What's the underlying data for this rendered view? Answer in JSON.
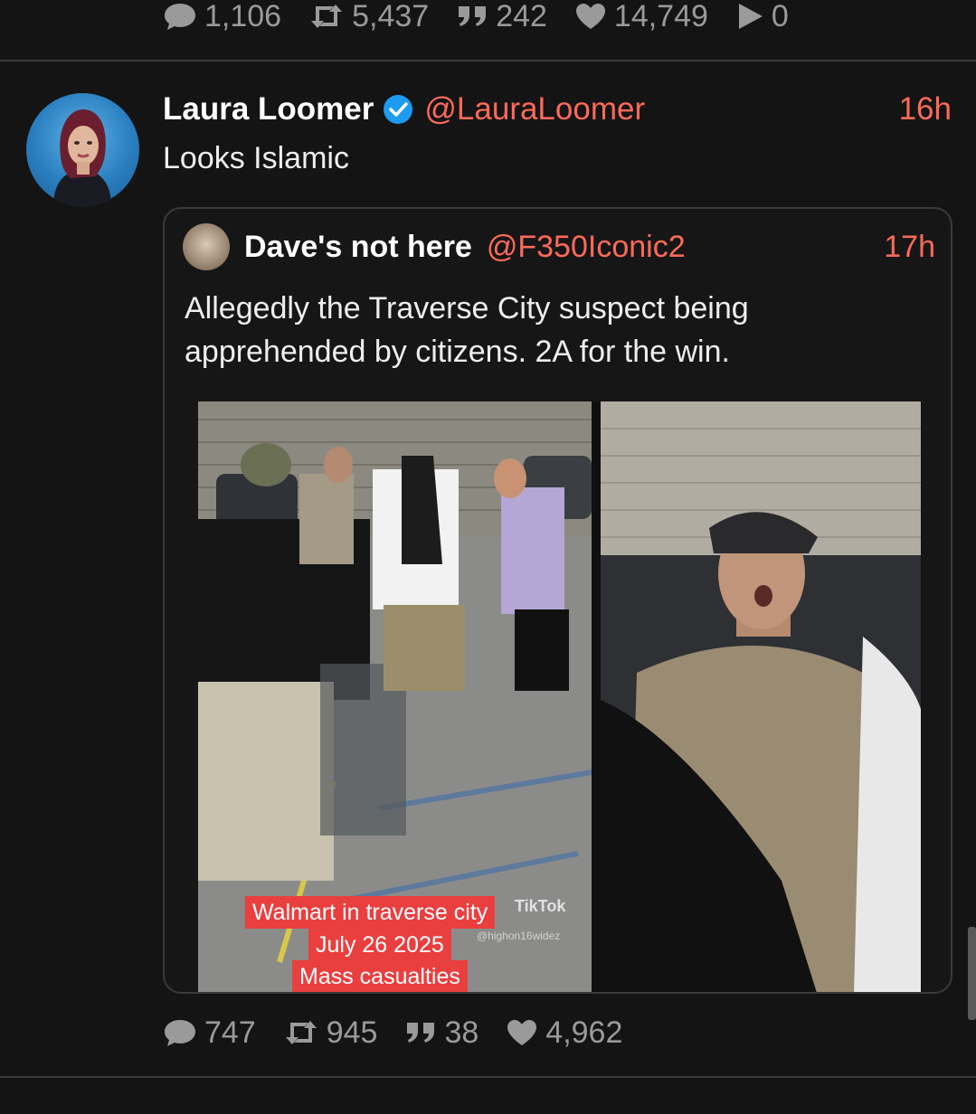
{
  "previous_post": {
    "stats": {
      "replies": "1,106",
      "reposts": "5,437",
      "quotes": "242",
      "likes": "14,749",
      "views": "0"
    }
  },
  "post": {
    "author": {
      "name": "Laura Loomer",
      "handle": "@LauraLoomer",
      "verified": true
    },
    "time": "16h",
    "text": "Looks Islamic",
    "quote": {
      "author": {
        "name": "Dave's not here",
        "handle": "@F350Iconic2"
      },
      "time": "17h",
      "text": "Allegedly the Traverse City suspect being apprehended by citizens. 2A for the win.",
      "media_caption": {
        "line1": "Walmart in traverse city",
        "line2": "July 26 2025",
        "line3": "Mass casualties"
      },
      "watermark": "TikTok",
      "watermark_user": "@highon16widez"
    },
    "stats": {
      "replies": "747",
      "reposts": "945",
      "quotes": "38",
      "likes": "4,962"
    }
  },
  "colors": {
    "accent": "#ff6a59",
    "verified": "#1d9bf0",
    "muted": "#9a9a9a",
    "background": "#141414"
  }
}
